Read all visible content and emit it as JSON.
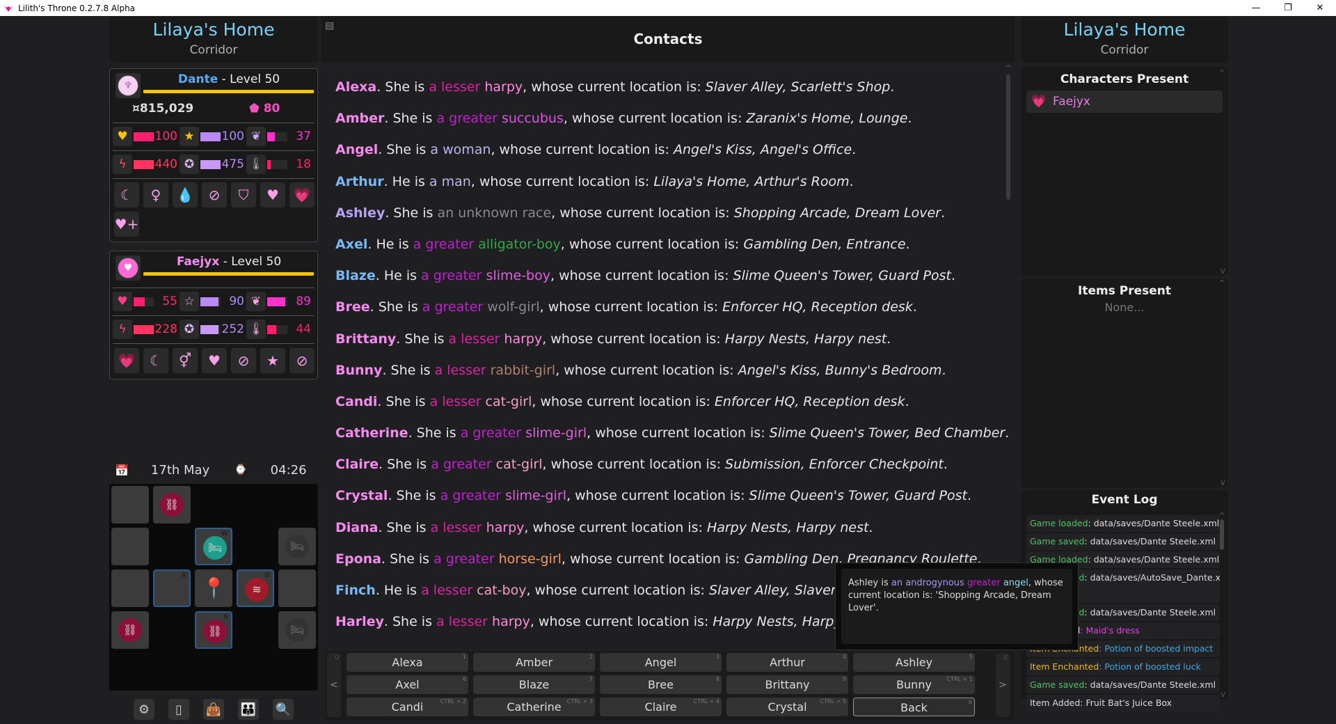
{
  "window": {
    "title": "Lilith's Throne 0.2.7.8 Alpha",
    "controls": [
      "—",
      "❐",
      "✕"
    ]
  },
  "location": {
    "area": "Lilaya's Home",
    "tile": "Corridor"
  },
  "player": {
    "name": "Dante",
    "level_text": " - Level 50",
    "name_color": "#5aa9f5",
    "money": "¤815,029",
    "essence": "80",
    "stats": [
      {
        "icon": "♥",
        "icon_color": "#f5c400",
        "value": "100",
        "fill": 1.0,
        "bar_color": "#ff1f6e",
        "text_color": "#ff2d6f"
      },
      {
        "icon": "★",
        "icon_color": "#f5c400",
        "value": "100",
        "fill": 1.0,
        "bar_color": "#b98af5",
        "text_color": "#a98cf5"
      },
      {
        "icon": "❦",
        "icon_color": "#c9a8f5",
        "value": "37",
        "fill": 0.37,
        "bar_color": "#ff33cc",
        "text_color": "#ff33cc"
      },
      {
        "icon": "ϟ",
        "icon_color": "#ff4a6a",
        "value": "440",
        "fill": 1.0,
        "bar_color": "#ff3560",
        "text_color": "#ff3560"
      },
      {
        "icon": "✪",
        "icon_color": "#d8b8f5",
        "value": "475",
        "fill": 1.0,
        "bar_color": "#c99af5",
        "text_color": "#b88cf5"
      },
      {
        "icon": "🌡",
        "icon_color": "#aaa",
        "value": "18",
        "fill": 0.18,
        "bar_color": "#ff1f6e",
        "text_color": "#ff1f6e"
      }
    ],
    "effects": [
      "☾",
      "♀",
      "💧",
      "⊘",
      "⛉",
      "♥",
      "💗",
      "♥+"
    ]
  },
  "companion": {
    "name": "Faejyx",
    "level_text": " - Level 50",
    "name_color": "#f58af0",
    "stats": [
      {
        "icon": "♥",
        "icon_color": "#ff3c8c",
        "value": "55",
        "fill": 0.55,
        "bar_color": "#ff1f6e",
        "text_color": "#ff2d6f"
      },
      {
        "icon": "☆",
        "icon_color": "#f5b8f0",
        "value": "90",
        "fill": 0.9,
        "bar_color": "#b98af5",
        "text_color": "#a98cf5"
      },
      {
        "icon": "❦",
        "icon_color": "#f5a8e0",
        "value": "89",
        "fill": 0.89,
        "bar_color": "#ff33cc",
        "text_color": "#ff33cc"
      },
      {
        "icon": "ϟ",
        "icon_color": "#ff4a6a",
        "value": "228",
        "fill": 1.0,
        "bar_color": "#ff3560",
        "text_color": "#ff3560"
      },
      {
        "icon": "✪",
        "icon_color": "#d8b8f5",
        "value": "252",
        "fill": 0.9,
        "bar_color": "#c99af5",
        "text_color": "#b88cf5"
      },
      {
        "icon": "🌡",
        "icon_color": "#f5a8d8",
        "value": "44",
        "fill": 0.44,
        "bar_color": "#ff1f6e",
        "text_color": "#ff1f6e"
      }
    ],
    "effects": [
      "💗",
      "☾",
      "⚥",
      "♥",
      "⊘",
      "★",
      "⊘"
    ]
  },
  "date": {
    "day": "17th May",
    "time": "04:26"
  },
  "map": {
    "labels": {
      "w": "W",
      "a": "A",
      "d": "D",
      "s": "S"
    }
  },
  "toolbar": [
    "⚙",
    "▯",
    "👜",
    "👪",
    "🔍"
  ],
  "main": {
    "title": "Contacts",
    "contacts": [
      {
        "name": "Alexa",
        "name_color": "#f58af0",
        "pronoun": ". She is ",
        "size": "a lesser",
        "size_color": "#e020a8",
        "race": " harpy",
        "race_color": "#ff8ae0",
        "loc": "Slaver Alley, Scarlett's Shop"
      },
      {
        "name": "Amber",
        "name_color": "#f58af0",
        "pronoun": ". She is ",
        "size": "a greater",
        "size_color": "#c020d0",
        "race": " succubus",
        "race_color": "#e050e8",
        "loc": "Zaranix's Home, Lounge"
      },
      {
        "name": "Angel",
        "name_color": "#f58af0",
        "pronoun": ". She is ",
        "size": "a",
        "size_color": "#b8b8f0",
        "race": " woman",
        "race_color": "#b8b8f0",
        "loc": "Angel's Kiss, Angel's Office"
      },
      {
        "name": "Arthur",
        "name_color": "#7ab8f5",
        "pronoun": ". He is ",
        "size": "a",
        "size_color": "#b8b8f0",
        "race": " man",
        "race_color": "#b8b8f0",
        "loc": "Lilaya's Home, Arthur's Room"
      },
      {
        "name": "Ashley",
        "name_color": "#b8a0f5",
        "pronoun": ". She is ",
        "size": "an unknown",
        "size_color": "#8a8a8a",
        "race": " race",
        "race_color": "#8a8a8a",
        "loc": "Shopping Arcade, Dream Lover"
      },
      {
        "name": "Axel",
        "name_color": "#7ab8f5",
        "pronoun": ". He is ",
        "size": "a greater",
        "size_color": "#c020d0",
        "race": " alligator-boy",
        "race_color": "#2ea84a",
        "loc": "Gambling Den, Entrance"
      },
      {
        "name": "Blaze",
        "name_color": "#7ab8f5",
        "pronoun": ". He is ",
        "size": "a greater",
        "size_color": "#c020d0",
        "race": " slime-boy",
        "race_color": "#e060e0",
        "loc": "Slime Queen's Tower, Guard Post"
      },
      {
        "name": "Bree",
        "name_color": "#f58af0",
        "pronoun": ". She is ",
        "size": "a greater",
        "size_color": "#c020d0",
        "race": " wolf-girl",
        "race_color": "#8a8a8a",
        "loc": "Enforcer HQ, Reception desk"
      },
      {
        "name": "Brittany",
        "name_color": "#f58af0",
        "pronoun": ". She is ",
        "size": "a lesser",
        "size_color": "#e020a8",
        "race": " harpy",
        "race_color": "#ff8ae0",
        "loc": "Harpy Nests, Harpy nest"
      },
      {
        "name": "Bunny",
        "name_color": "#f58af0",
        "pronoun": ". She is ",
        "size": "a lesser",
        "size_color": "#e020a8",
        "race": " rabbit-girl",
        "race_color": "#b08070",
        "loc": "Angel's Kiss, Bunny's Bedroom"
      },
      {
        "name": "Candi",
        "name_color": "#f58af0",
        "pronoun": ". She is ",
        "size": "a lesser",
        "size_color": "#e020a8",
        "race": " cat-girl",
        "race_color": "#f5a0c0",
        "loc": "Enforcer HQ, Reception desk"
      },
      {
        "name": "Catherine",
        "name_color": "#f58af0",
        "pronoun": ". She is ",
        "size": "a greater",
        "size_color": "#c020d0",
        "race": " slime-girl",
        "race_color": "#e060e0",
        "loc": "Slime Queen's Tower, Bed Chamber"
      },
      {
        "name": "Claire",
        "name_color": "#f58af0",
        "pronoun": ". She is ",
        "size": "a greater",
        "size_color": "#c020d0",
        "race": " cat-girl",
        "race_color": "#f5a0c0",
        "loc": "Submission, Enforcer Checkpoint"
      },
      {
        "name": "Crystal",
        "name_color": "#f58af0",
        "pronoun": ". She is ",
        "size": "a greater",
        "size_color": "#c020d0",
        "race": " slime-girl",
        "race_color": "#e060e0",
        "loc": "Slime Queen's Tower, Guard Post"
      },
      {
        "name": "Diana",
        "name_color": "#f58af0",
        "pronoun": ". She is ",
        "size": "a lesser",
        "size_color": "#e020a8",
        "race": " harpy",
        "race_color": "#ff8ae0",
        "loc": "Harpy Nests, Harpy nest"
      },
      {
        "name": "Epona",
        "name_color": "#f58af0",
        "pronoun": ". She is ",
        "size": "a greater",
        "size_color": "#c020d0",
        "race": " horse-girl",
        "race_color": "#f59a60",
        "loc": "Gambling Den, Pregnancy Roulette"
      },
      {
        "name": "Finch",
        "name_color": "#7ab8f5",
        "pronoun": ". He is ",
        "size": "a lesser",
        "size_color": "#e020a8",
        "race": " cat-boy",
        "race_color": "#f5a0c0",
        "loc": "Slaver Alley, Slavery Administration"
      },
      {
        "name": "Harley",
        "name_color": "#f58af0",
        "pronoun": ". She is ",
        "size": "a lesser",
        "size_color": "#e020a8",
        "race": " harpy",
        "race_color": "#ff8ae0",
        "loc": "Harpy Nests, Harpy nest"
      }
    ],
    "location_prefix": ", whose current location is: "
  },
  "buttons": {
    "prev": {
      "label": "<",
      "key": "Q"
    },
    "next": {
      "label": ">",
      "key": "E"
    },
    "grid": [
      {
        "label": "Alexa",
        "key": "1"
      },
      {
        "label": "Amber",
        "key": "2"
      },
      {
        "label": "Angel",
        "key": "3"
      },
      {
        "label": "Arthur",
        "key": "4"
      },
      {
        "label": "Ashley",
        "key": "5"
      },
      {
        "label": "Axel",
        "key": "6"
      },
      {
        "label": "Blaze",
        "key": "7"
      },
      {
        "label": "Bree",
        "key": "8"
      },
      {
        "label": "Brittany",
        "key": "9"
      },
      {
        "label": "Bunny",
        "key": "CTRL + 1"
      },
      {
        "label": "Candi",
        "key": "CTRL + 2"
      },
      {
        "label": "Catherine",
        "key": "CTRL + 3"
      },
      {
        "label": "Claire",
        "key": "CTRL + 4"
      },
      {
        "label": "Crystal",
        "key": "CTRL + 5"
      },
      {
        "label": "Back",
        "key": "0"
      }
    ]
  },
  "right": {
    "characters_title": "Characters Present",
    "characters": [
      {
        "name": "Faejyx"
      }
    ],
    "items_title": "Items Present",
    "items_empty": "None...",
    "log_title": "Event Log",
    "log": [
      {
        "tag": "Game loaded",
        "tag_color": "#4ec464",
        "text": ": data/saves/Dante Steele.xml",
        "text_color": "#ddd"
      },
      {
        "tag": "Game saved",
        "tag_color": "#4ec464",
        "text": ": data/saves/Dante Steele.xml",
        "text_color": "#ddd"
      },
      {
        "tag": "Game loaded",
        "tag_color": "#4ec464",
        "text": ": data/saves/Dante Steele.xml",
        "text_color": "#ddd"
      },
      {
        "tag": "Game saved",
        "tag_color": "#4ec464",
        "text": ": data/saves/AutoSave_Dante.xml",
        "text_color": "#ddd",
        "tall": true
      },
      {
        "tag": "Game saved",
        "tag_color": "#4ec464",
        "text": ": data/saves/Dante Steele.xml",
        "text_color": "#ddd"
      },
      {
        "tag": "Item Added",
        "tag_color": "#ddd",
        "text": ": Maid's dress",
        "text_color": "#d845e0"
      },
      {
        "tag": "Item Enchanted",
        "tag_color": "#e8b820",
        "text": ": Potion of boosted impact",
        "text_color": "#3aa8e8"
      },
      {
        "tag": "Item Enchanted",
        "tag_color": "#e8b820",
        "text": ": Potion of boosted luck",
        "text_color": "#3aa8e8"
      },
      {
        "tag": "Game saved",
        "tag_color": "#4ec464",
        "text": ": data/saves/Dante Steele.xml",
        "text_color": "#ddd"
      },
      {
        "tag": "Item Added",
        "tag_color": "#ddd",
        "text": ": Fruit Bat's Juice Box",
        "text_color": "#ddd"
      }
    ]
  },
  "tooltip": {
    "parts": [
      {
        "t": "Ashley is ",
        "c": "#ddd"
      },
      {
        "t": "an androgynous",
        "c": "#a89af5"
      },
      {
        "t": " greater",
        "c": "#c020d0"
      },
      {
        "t": " angel",
        "c": "#8ad8f5"
      },
      {
        "t": ", whose current location is: 'Shopping Arcade, Dream Lover'.",
        "c": "#ddd"
      }
    ]
  }
}
